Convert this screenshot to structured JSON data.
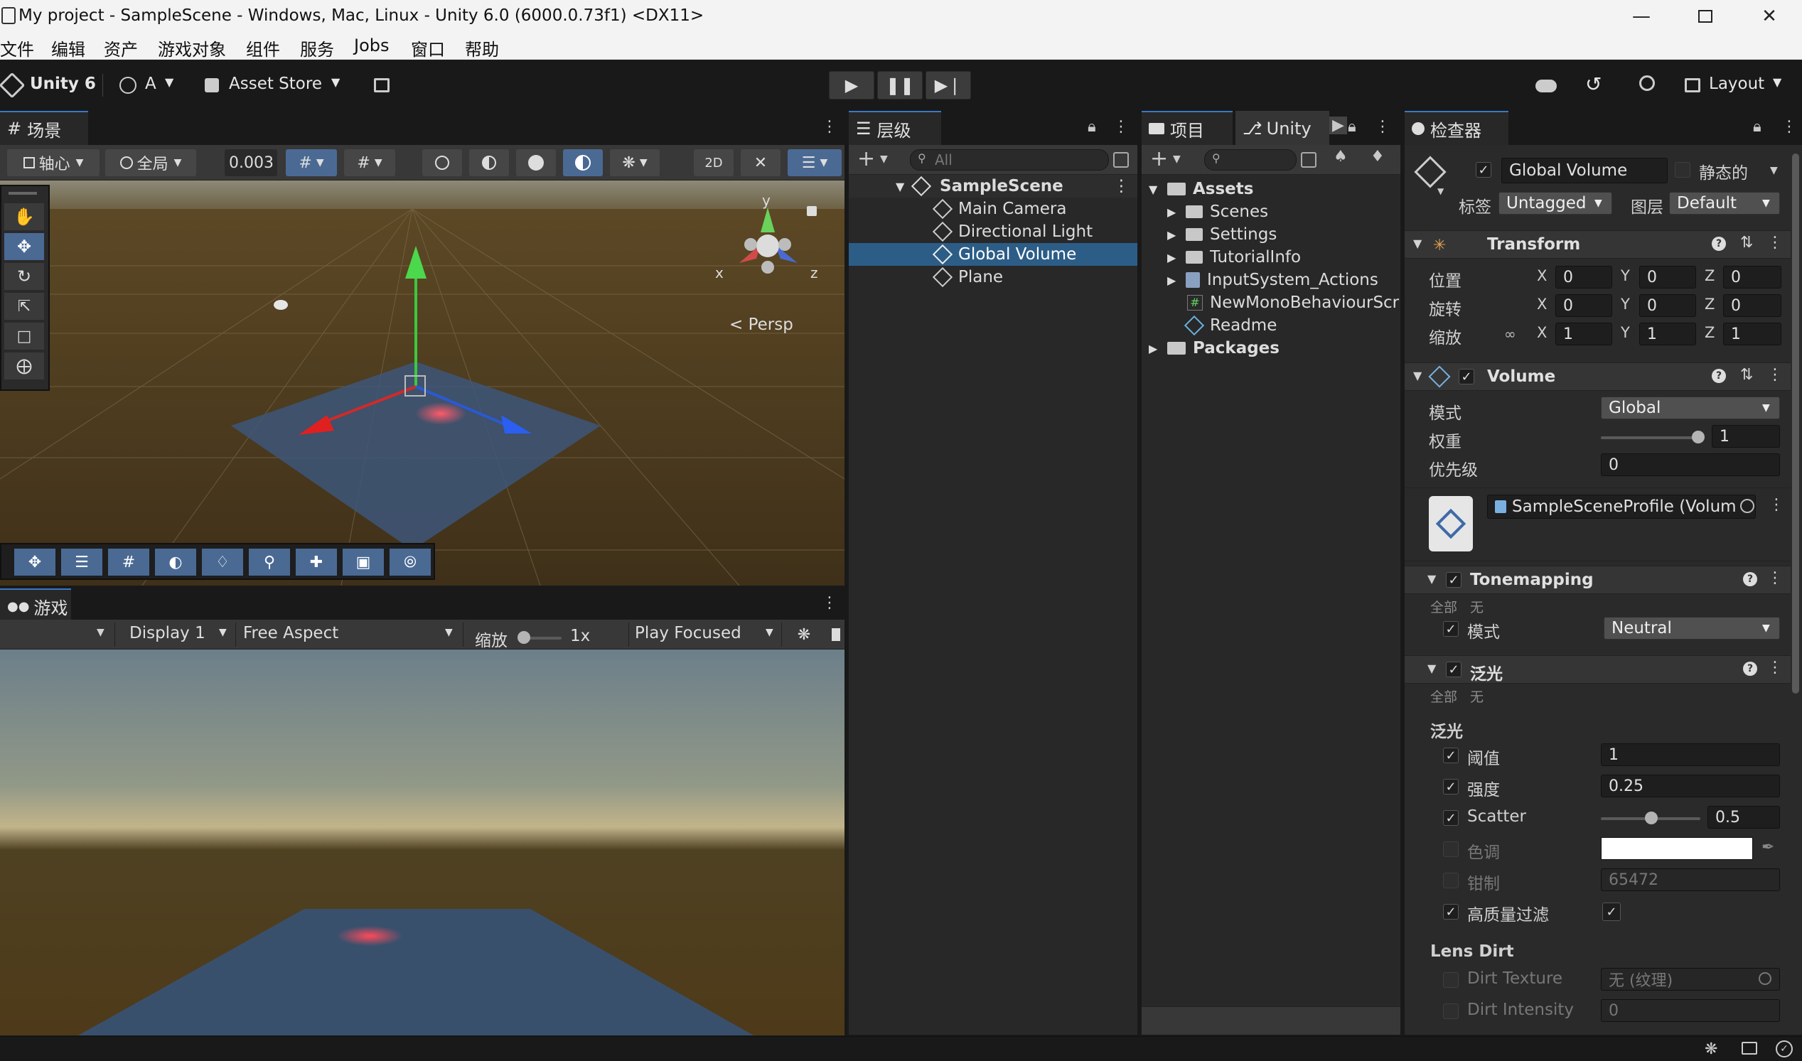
{
  "window": {
    "title": "My project - SampleScene - Windows, Mac, Linux - Unity 6.0 (6000.0.73f1) <DX11>"
  },
  "menu": [
    "文件",
    "编辑",
    "资产",
    "游戏对象",
    "组件",
    "服务",
    "Jobs",
    "窗口",
    "帮助"
  ],
  "toolbar": {
    "brand": "Unity 6",
    "account": "A",
    "asset_store": "Asset Store",
    "layout": "Layout"
  },
  "scene": {
    "tab": "场景",
    "pivot": "轴心",
    "global": "全局",
    "snap_value": "0.003",
    "persp_label": "Persp",
    "gizmo": {
      "x": "x",
      "y": "y",
      "z": "z"
    }
  },
  "game": {
    "tab": "游戏",
    "display": "Display 1",
    "aspect": "Free Aspect",
    "scale_label": "缩放",
    "scale_value": "1x",
    "play_mode": "Play Focused"
  },
  "hierarchy": {
    "tab": "层级",
    "search_placeholder": "All",
    "scene_name": "SampleScene",
    "items": [
      "Main Camera",
      "Directional Light",
      "Global Volume",
      "Plane"
    ],
    "selected": "Global Volume"
  },
  "project": {
    "tab": "项目",
    "tab2": "Unity",
    "tree": [
      {
        "name": "Assets",
        "kind": "folder",
        "expanded": true
      },
      {
        "name": "Scenes",
        "kind": "folder"
      },
      {
        "name": "Settings",
        "kind": "folder"
      },
      {
        "name": "TutorialInfo",
        "kind": "folder"
      },
      {
        "name": "InputSystem_Actions",
        "kind": "asset"
      },
      {
        "name": "NewMonoBehaviourScr",
        "kind": "script"
      },
      {
        "name": "Readme",
        "kind": "readme"
      },
      {
        "name": "Packages",
        "kind": "folder"
      }
    ]
  },
  "inspector": {
    "tab": "检查器",
    "object_name": "Global Volume",
    "static_label": "静态的",
    "tag_label": "标签",
    "tag_value": "Untagged",
    "layer_label": "图层",
    "layer_value": "Default",
    "transform": {
      "title": "Transform",
      "position_label": "位置",
      "rotation_label": "旋转",
      "scale_label": "缩放",
      "position": [
        "0",
        "0",
        "0"
      ],
      "rotation": [
        "0",
        "0",
        "0"
      ],
      "scale": [
        "1",
        "1",
        "1"
      ],
      "axis": [
        "X",
        "Y",
        "Z"
      ]
    },
    "volume": {
      "title": "Volume",
      "mode_label": "模式",
      "mode_value": "Global",
      "weight_label": "权重",
      "weight_value": "1",
      "weight_level": 1,
      "priority_label": "优先级",
      "priority_value": "0",
      "profile": "SampleSceneProfile (Volum"
    },
    "tonemapping": {
      "title": "Tonemapping",
      "all": "全部",
      "none": "无",
      "mode_label": "模式",
      "mode_value": "Neutral"
    },
    "bloom": {
      "title": "泛光",
      "all": "全部",
      "none": "无",
      "section": "泛光",
      "threshold_label": "阈值",
      "threshold_value": "1",
      "intensity_label": "强度",
      "intensity_value": "0.25",
      "scatter_label": "Scatter",
      "scatter_value": "0.5",
      "scatter_level": 0.5,
      "tint_label": "色调",
      "tint_color": "#ffffff",
      "clamp_label": "钳制",
      "clamp_value": "65472",
      "hq_label": "高质量过滤",
      "lens_dirt": "Lens Dirt",
      "dirt_texture_label": "Dirt Texture",
      "dirt_texture_value": "无 (纹理)",
      "dirt_intensity_label": "Dirt Intensity",
      "dirt_intensity_value": "0"
    }
  },
  "colors": {
    "accent": "#3a78c4",
    "selection": "#2c5d87",
    "panel": "#282828",
    "toolbar": "#191919"
  }
}
